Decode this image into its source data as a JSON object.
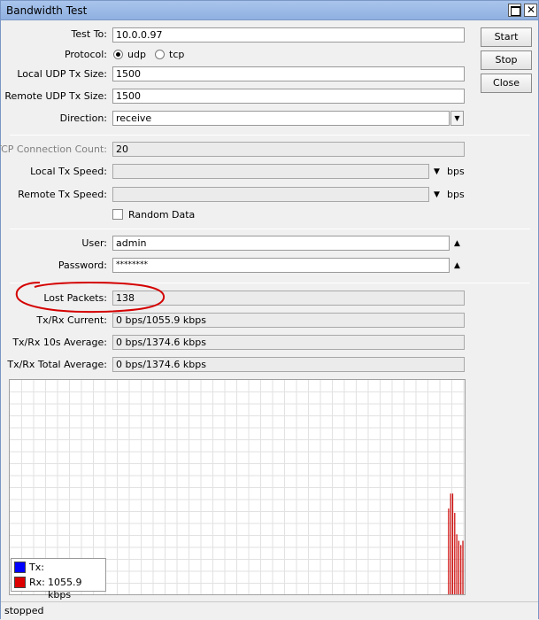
{
  "window": {
    "title": "Bandwidth Test"
  },
  "buttons": {
    "start": "Start",
    "stop": "Stop",
    "close": "Close"
  },
  "form": {
    "test_to": {
      "label": "Test To:",
      "value": "10.0.0.97"
    },
    "protocol": {
      "label": "Protocol:",
      "options": [
        "udp",
        "tcp"
      ],
      "selected": "udp"
    },
    "local_udp_tx_size": {
      "label": "Local UDP Tx Size:",
      "value": "1500"
    },
    "remote_udp_tx_size": {
      "label": "Remote UDP Tx Size:",
      "value": "1500"
    },
    "direction": {
      "label": "Direction:",
      "value": "receive"
    },
    "tcp_connection_count": {
      "label": "TCP Connection Count:",
      "value": "20"
    },
    "local_tx_speed": {
      "label": "Local Tx Speed:",
      "value": "",
      "unit": "bps"
    },
    "remote_tx_speed": {
      "label": "Remote Tx Speed:",
      "value": "",
      "unit": "bps"
    },
    "random_data": {
      "label": "Random Data",
      "checked": false
    },
    "user": {
      "label": "User:",
      "value": "admin"
    },
    "password": {
      "label": "Password:",
      "value": "********"
    }
  },
  "results": {
    "lost_packets": {
      "label": "Lost Packets:",
      "value": "138"
    },
    "current": {
      "label": "Tx/Rx Current:",
      "value": "0 bps/1055.9 kbps"
    },
    "avg10": {
      "label": "Tx/Rx 10s Average:",
      "value": "0 bps/1374.6 kbps"
    },
    "total_avg": {
      "label": "Tx/Rx Total Average:",
      "value": "0 bps/1374.6 kbps"
    }
  },
  "graph": {
    "legend": [
      {
        "name": "Tx:",
        "value": "",
        "color": "#0000ff"
      },
      {
        "name": "Rx:",
        "value": "1055.9 kbps",
        "color": "#dd0000"
      }
    ],
    "rx_bar_levels": [
      0.4,
      0.47,
      0.47,
      0.38,
      0.28,
      0.25,
      0.23,
      0.25
    ],
    "tx_color": "#0000ff",
    "rx_color": "#cc0000"
  },
  "status": {
    "text": "stopped"
  },
  "annotation_color": "#d40000"
}
